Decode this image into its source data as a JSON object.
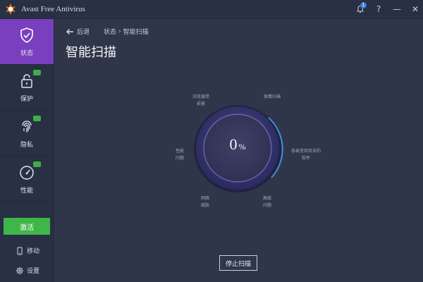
{
  "window": {
    "title": "Avast Free Antivirus",
    "notification_count": "1",
    "controls": {
      "help": "?",
      "minimize": "—",
      "close": "✕"
    }
  },
  "sidebar": {
    "items": [
      {
        "label": "状态",
        "icon": "shield-check-icon",
        "active": true
      },
      {
        "label": "保护",
        "icon": "lock-icon",
        "active": false
      },
      {
        "label": "隐私",
        "icon": "fingerprint-icon",
        "active": false
      },
      {
        "label": "性能",
        "icon": "speedometer-icon",
        "active": false
      }
    ],
    "activate_label": "激活",
    "mobile_label": "移动",
    "settings_label": "设置"
  },
  "main": {
    "back_label": "后退",
    "breadcrumb": [
      "状态",
      "智能扫描"
    ],
    "breadcrumb_sep": "›",
    "title": "智能扫描"
  },
  "scan": {
    "progress_percent": 0,
    "percent_text": "0",
    "percent_sign": "%",
    "labels": {
      "top_left": [
        "浏览器受",
        "损害"
      ],
      "top_right": [
        "病毒扫描"
      ],
      "left": [
        "性能",
        "问题"
      ],
      "right": [
        "容易受到攻击的",
        "软件"
      ],
      "bottom_left": [
        "网络",
        "威胁"
      ],
      "bottom_right": [
        "高级",
        "问题"
      ]
    },
    "stop_label": "停止扫描"
  },
  "colors": {
    "accent_active": "#7a3fbf",
    "activate_green": "#3fb64a",
    "background": "#2f3649",
    "ring_highlight": "#3f8ce0"
  }
}
